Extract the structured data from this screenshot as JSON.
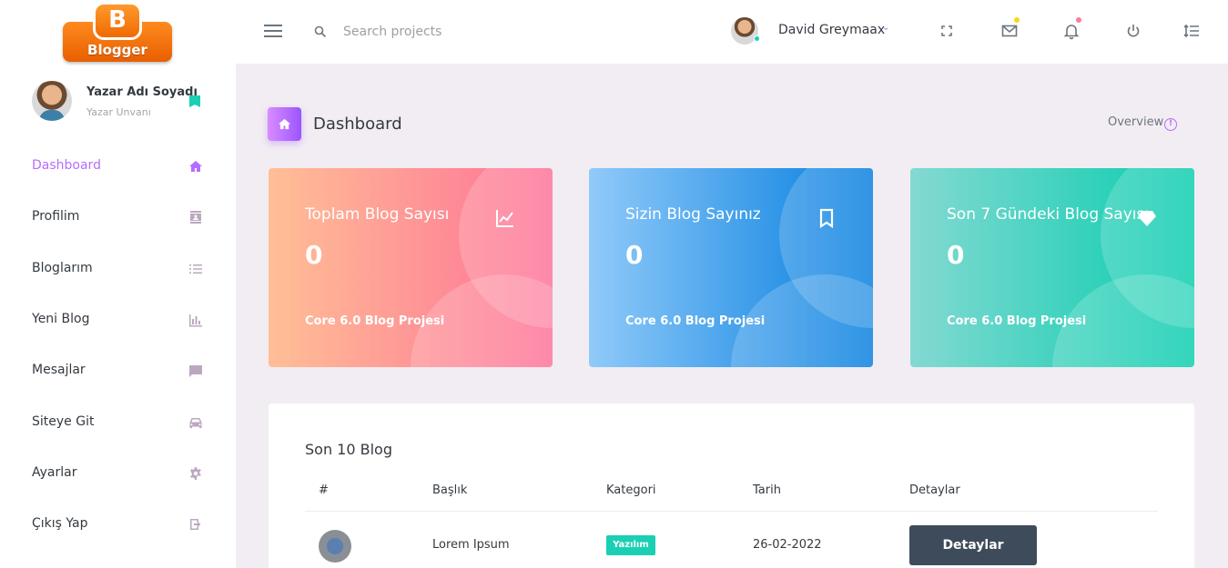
{
  "logo": {
    "letter": "B",
    "text": "Blogger"
  },
  "profile": {
    "name": "Yazar Adı Soyadı",
    "title": "Yazar Unvanı"
  },
  "sidebar": {
    "items": [
      {
        "label": "Dashboard",
        "icon": "home-icon",
        "active": true
      },
      {
        "label": "Profilim",
        "icon": "contact-card-icon"
      },
      {
        "label": "Bloglarım",
        "icon": "list-icon"
      },
      {
        "label": "Yeni Blog",
        "icon": "bar-chart-icon"
      },
      {
        "label": "Mesajlar",
        "icon": "message-icon"
      },
      {
        "label": "Siteye Git",
        "icon": "car-icon"
      },
      {
        "label": "Ayarlar",
        "icon": "gear-icon"
      },
      {
        "label": "Çıkış Yap",
        "icon": "logout-icon"
      }
    ]
  },
  "topbar": {
    "search_placeholder": "Search projects",
    "username": "David Greymaax",
    "caret": "⌄"
  },
  "page": {
    "title": "Dashboard",
    "overview": "Overview",
    "overview_icon": "!"
  },
  "cards": [
    {
      "title": "Toplam Blog Sayısı",
      "value": "0",
      "footer": "Core 6.0 Blog Projesi",
      "icon": "line-chart-icon"
    },
    {
      "title": "Sizin Blog Sayınız",
      "value": "0",
      "footer": "Core 6.0 Blog Projesi",
      "icon": "bookmark-icon"
    },
    {
      "title": "Son 7 Gündeki Blog Sayısı",
      "value": "0",
      "footer": "Core 6.0 Blog Projesi",
      "icon": "diamond-icon"
    }
  ],
  "table": {
    "title": "Son 10 Blog",
    "headers": [
      "#",
      "Başlık",
      "Kategori",
      "Tarih",
      "Detaylar"
    ],
    "rows": [
      {
        "title": "Lorem Ipsum",
        "category": "Yazılım",
        "date": "26-02-2022",
        "action": "Detaylar"
      }
    ]
  },
  "colors": {
    "accent": "#b66dff",
    "success": "#1bcfb4",
    "dark_button": "#3e4b5b"
  }
}
